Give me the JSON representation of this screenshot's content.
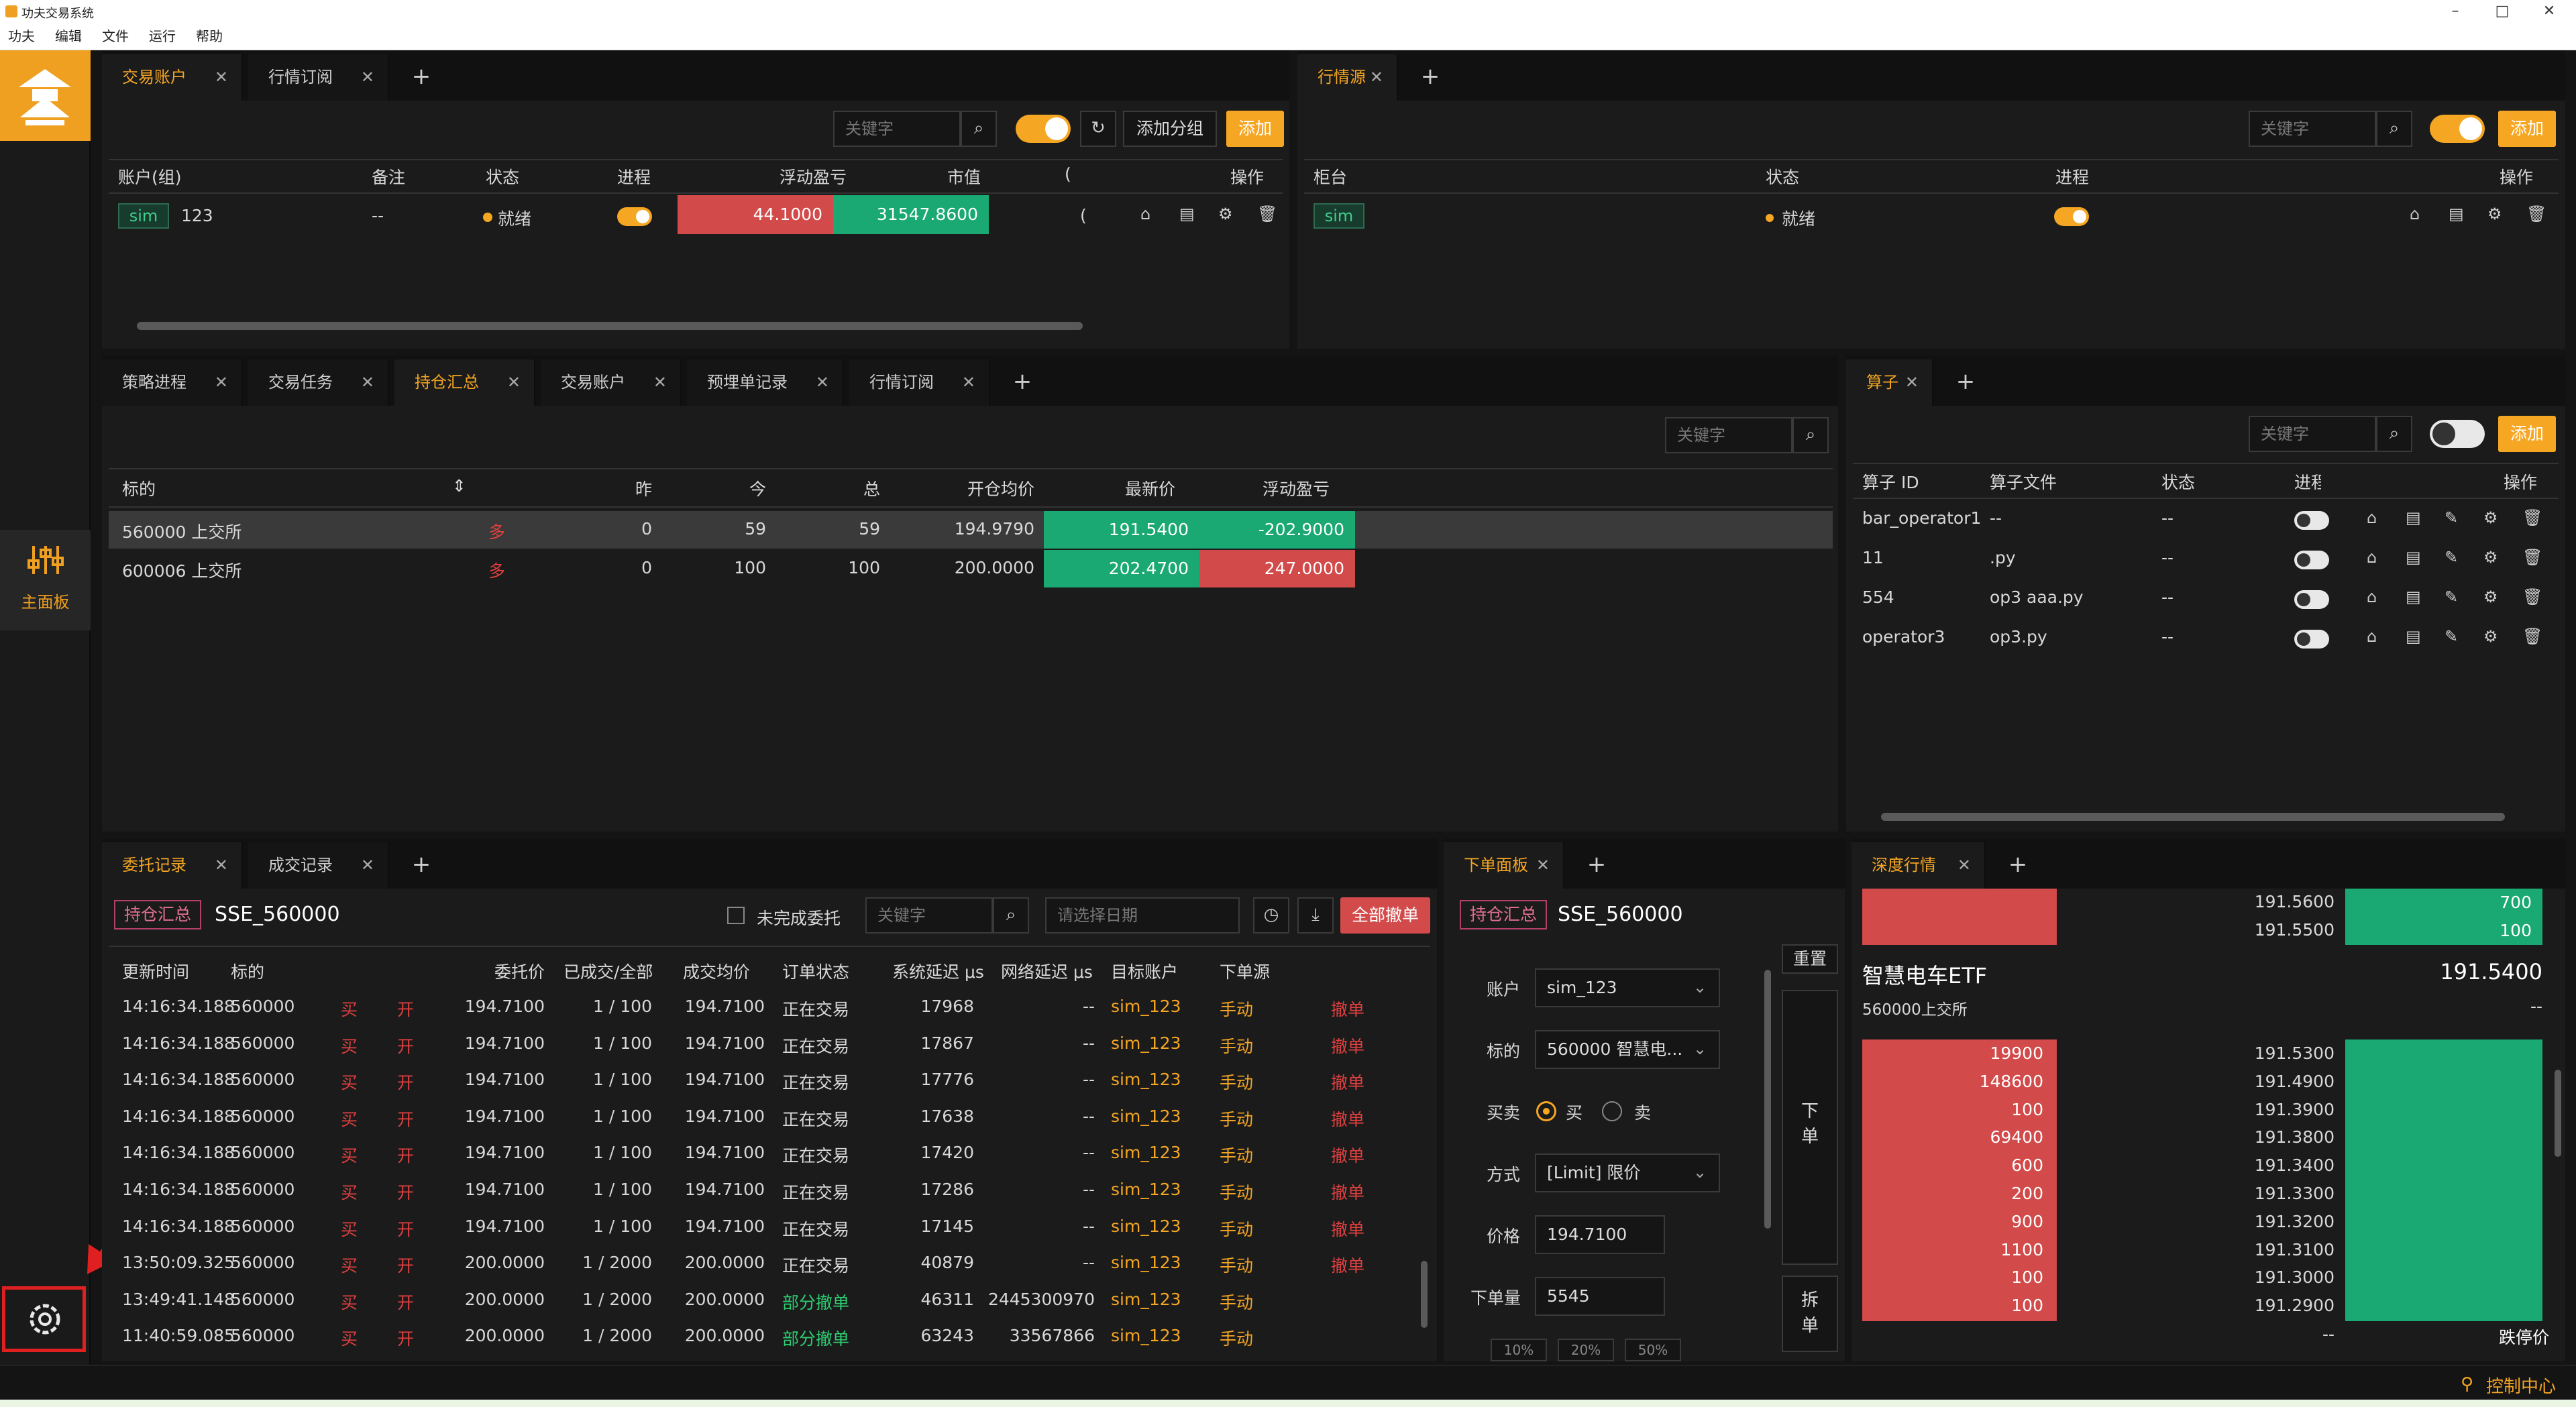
{
  "window": {
    "title": "功夫交易系统",
    "min": "–",
    "max": "□",
    "close": "✕"
  },
  "menu": [
    "功夫",
    "编辑",
    "文件",
    "运行",
    "帮助"
  ],
  "nav": {
    "main_label": "主面板"
  },
  "accounts_panel": {
    "tabs": [
      "交易账户",
      "行情订阅"
    ],
    "search_placeholder": "关键字",
    "add_group": "添加分组",
    "add": "添加",
    "headers": [
      "账户(组)",
      "备注",
      "状态",
      "进程",
      "浮动盈亏",
      "市值",
      "(",
      "操作"
    ],
    "row": {
      "tag": "sim",
      "id": "123",
      "note": "--",
      "status": "就绪",
      "pnl": "44.1000",
      "value": "31547.8600",
      "trunc": "("
    }
  },
  "md_panel": {
    "tabs": [
      "行情源"
    ],
    "search_placeholder": "关键字",
    "add": "添加",
    "headers": [
      "柜台",
      "状态",
      "进程",
      "操作"
    ],
    "row": {
      "tag": "sim",
      "status": "就绪"
    }
  },
  "positions_panel": {
    "tabs": [
      "策略进程",
      "交易任务",
      "持仓汇总",
      "交易账户",
      "预埋单记录",
      "行情订阅"
    ],
    "active": 2,
    "search_placeholder": "关键字",
    "headers": [
      "标的",
      "昨",
      "今",
      "总",
      "开仓均价",
      "最新价",
      "浮动盈亏"
    ],
    "rows": [
      {
        "symbol": "560000 上交所",
        "dir": "多",
        "yd": "0",
        "td": "59",
        "total": "59",
        "avg": "194.9790",
        "last": "191.5400",
        "pnl": "-202.9000"
      },
      {
        "symbol": "600006 上交所",
        "dir": "多",
        "yd": "0",
        "td": "100",
        "total": "100",
        "avg": "200.0000",
        "last": "202.4700",
        "pnl": "247.0000"
      }
    ]
  },
  "operator_panel": {
    "tabs": [
      "算子"
    ],
    "search_placeholder": "关键字",
    "add": "添加",
    "headers": [
      "算子 ID",
      "算子文件",
      "状态",
      "进程",
      "操作"
    ],
    "rows": [
      {
        "id": "bar_operator1",
        "file": "--",
        "status": "--"
      },
      {
        "id": "11",
        "file": ".py",
        "status": "--"
      },
      {
        "id": "554",
        "file": "op3 aaa.py",
        "status": "--"
      },
      {
        "id": "operator3",
        "file": "op3.py",
        "status": "--"
      }
    ]
  },
  "orders_panel": {
    "tabs": [
      "委托记录",
      "成交记录"
    ],
    "tag": "持仓汇总",
    "instrument": "SSE_560000",
    "unfinished_label": "未完成委托",
    "search_placeholder": "关键字",
    "date_placeholder": "请选择日期",
    "cancel_all": "全部撤单",
    "headers": [
      "更新时间",
      "标的",
      "委托价",
      "已成交/全部",
      "成交均价",
      "订单状态",
      "系统延迟 μs",
      "网络延迟 μs",
      "目标账户",
      "下单源"
    ],
    "rows": [
      {
        "time": "14:16:34.188",
        "sym": "560000",
        "side": "买",
        "off": "开",
        "price": "194.7100",
        "filled": "1 / 100",
        "avg": "194.7100",
        "status": "正在交易",
        "sys": "17968",
        "net": "--",
        "acct": "sim_123",
        "src": "手动",
        "act": "撤单"
      },
      {
        "time": "14:16:34.188",
        "sym": "560000",
        "side": "买",
        "off": "开",
        "price": "194.7100",
        "filled": "1 / 100",
        "avg": "194.7100",
        "status": "正在交易",
        "sys": "17867",
        "net": "--",
        "acct": "sim_123",
        "src": "手动",
        "act": "撤单"
      },
      {
        "time": "14:16:34.188",
        "sym": "560000",
        "side": "买",
        "off": "开",
        "price": "194.7100",
        "filled": "1 / 100",
        "avg": "194.7100",
        "status": "正在交易",
        "sys": "17776",
        "net": "--",
        "acct": "sim_123",
        "src": "手动",
        "act": "撤单"
      },
      {
        "time": "14:16:34.188",
        "sym": "560000",
        "side": "买",
        "off": "开",
        "price": "194.7100",
        "filled": "1 / 100",
        "avg": "194.7100",
        "status": "正在交易",
        "sys": "17638",
        "net": "--",
        "acct": "sim_123",
        "src": "手动",
        "act": "撤单"
      },
      {
        "time": "14:16:34.188",
        "sym": "560000",
        "side": "买",
        "off": "开",
        "price": "194.7100",
        "filled": "1 / 100",
        "avg": "194.7100",
        "status": "正在交易",
        "sys": "17420",
        "net": "--",
        "acct": "sim_123",
        "src": "手动",
        "act": "撤单"
      },
      {
        "time": "14:16:34.188",
        "sym": "560000",
        "side": "买",
        "off": "开",
        "price": "194.7100",
        "filled": "1 / 100",
        "avg": "194.7100",
        "status": "正在交易",
        "sys": "17286",
        "net": "--",
        "acct": "sim_123",
        "src": "手动",
        "act": "撤单"
      },
      {
        "time": "14:16:34.188",
        "sym": "560000",
        "side": "买",
        "off": "开",
        "price": "194.7100",
        "filled": "1 / 100",
        "avg": "194.7100",
        "status": "正在交易",
        "sys": "17145",
        "net": "--",
        "acct": "sim_123",
        "src": "手动",
        "act": "撤单"
      },
      {
        "time": "13:50:09.325",
        "sym": "560000",
        "side": "买",
        "off": "开",
        "price": "200.0000",
        "filled": "1 / 2000",
        "avg": "200.0000",
        "status": "正在交易",
        "sys": "40879",
        "net": "--",
        "acct": "sim_123",
        "src": "手动",
        "act": "撤单"
      },
      {
        "time": "13:49:41.148",
        "sym": "560000",
        "side": "买",
        "off": "开",
        "price": "200.0000",
        "filled": "1 / 2000",
        "avg": "200.0000",
        "status": "部分撤单",
        "sys": "46311",
        "net": "2445300970",
        "acct": "sim_123",
        "src": "手动",
        "act": ""
      },
      {
        "time": "11:40:59.085",
        "sym": "560000",
        "side": "买",
        "off": "开",
        "price": "200.0000",
        "filled": "1 / 2000",
        "avg": "200.0000",
        "status": "部分撤单",
        "sys": "63243",
        "net": "33567866",
        "acct": "sim_123",
        "src": "手动",
        "act": ""
      }
    ]
  },
  "order_panel": {
    "tabs": [
      "下单面板"
    ],
    "tag": "持仓汇总",
    "instrument": "SSE_560000",
    "reset": "重置",
    "account_label": "账户",
    "account": "sim_123",
    "symbol_label": "标的",
    "symbol": "560000 智慧电...",
    "side_label": "买卖",
    "buy": "买",
    "sell": "卖",
    "type_label": "方式",
    "type": "[Limit] 限价",
    "price_label": "价格",
    "price": "194.7100",
    "qty_label": "下单量",
    "qty": "5545",
    "submit": "下单",
    "split": "拆单",
    "pct": [
      "10%",
      "20%",
      "50%"
    ]
  },
  "depth_panel": {
    "tabs": [
      "深度行情"
    ],
    "name": "智慧电车ETF",
    "code": "560000上交所",
    "last": "191.5400",
    "dash": "--",
    "asks": [
      {
        "price": "191.5600",
        "vol": "700"
      },
      {
        "price": "191.5500",
        "vol": "100"
      }
    ],
    "bids": [
      {
        "vol": "19900",
        "price": "191.5300"
      },
      {
        "vol": "148600",
        "price": "191.4900"
      },
      {
        "vol": "100",
        "price": "191.3900"
      },
      {
        "vol": "69400",
        "price": "191.3800"
      },
      {
        "vol": "600",
        "price": "191.3400"
      },
      {
        "vol": "200",
        "price": "191.3300"
      },
      {
        "vol": "900",
        "price": "191.3200"
      },
      {
        "vol": "1100",
        "price": "191.3100"
      },
      {
        "vol": "100",
        "price": "191.3000"
      },
      {
        "vol": "100",
        "price": "191.2900"
      }
    ],
    "limit_down_label": "跌停价",
    "limit_down": "--"
  },
  "statusbar": {
    "control": "控制中心"
  },
  "colors": {
    "accent": "#f5a623",
    "red": "#d24a4a",
    "green": "#1aa873"
  }
}
